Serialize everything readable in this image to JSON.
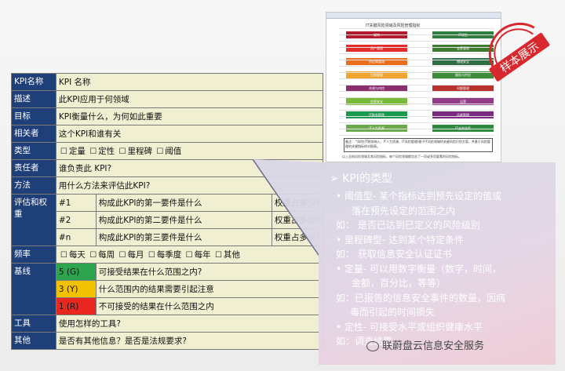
{
  "table": {
    "rows": [
      {
        "label": "KPI名称",
        "value": "KPI 名称"
      },
      {
        "label": "描述",
        "value": "此KPI应用于何领域"
      },
      {
        "label": "目标",
        "value": "KPI衡量什么，为何如此重要"
      },
      {
        "label": "相关者",
        "value": "这个KPI和谁有关"
      }
    ],
    "type_label": "类型",
    "type_options": [
      "定量",
      "定性",
      "里程碑",
      "阈值"
    ],
    "owner_label": "责任者",
    "owner_value": "谁负责此 KPI?",
    "method_label": "方法",
    "method_value": "用什么方法来评估此KPI?",
    "weight_label": "评估和权重",
    "weight_rows": [
      {
        "idx": "#1",
        "desc": "构成此KPI的第一要件是什么",
        "wt": "权重占多少?"
      },
      {
        "idx": "#2",
        "desc": "构成此KPI的第二要件是什么",
        "wt": "权重占多少?"
      },
      {
        "idx": "#n",
        "desc": "构成此KPI的第三要件是什么",
        "wt": "权重占多少?"
      }
    ],
    "freq_label": "频率",
    "freq_options": [
      "每天",
      "每周",
      "每月",
      "每季度",
      "每年",
      "其他"
    ],
    "baseline_label": "基线",
    "baseline_rows": [
      {
        "level": "5 (G)",
        "desc": "可接受结果在什么范围之内?"
      },
      {
        "level": "3 (Y)",
        "desc": "什么范围内的结果需要引起注意"
      },
      {
        "level": "1 (R)",
        "desc": "不可接受的结果在什么范围之内"
      }
    ],
    "tools_label": "工具",
    "tools_value": "使用怎样的工具?",
    "other_label": "其他",
    "other_value": "是否有其他信息？是否是法规要求?"
  },
  "sheet": {
    "title": "IT关键风险领域及风险管理指标",
    "bars": [
      {
        "label": "架构",
        "color": "#b01c2e"
      },
      {
        "label": "IT项目",
        "color": "#2c7d3e"
      },
      {
        "label": "资产管理",
        "color": "#e32d2d"
      },
      {
        "label": "变更管理",
        "color": "#3f7a31"
      },
      {
        "label": "供应商管理",
        "color": "#ec6e1c"
      },
      {
        "label": "物理安全",
        "color": "#2f6d46"
      },
      {
        "label": "日常管理",
        "color": "#f0a431"
      },
      {
        "label": "服务与供应",
        "color": "#3c8c3a"
      },
      {
        "label": "合规与内控",
        "color": "#8a2f6e"
      },
      {
        "label": "问题管理",
        "color": "#b8322e"
      },
      {
        "label": "信息安全",
        "color": "#7ab83a"
      },
      {
        "label": "运营",
        "color": "#933b86"
      },
      {
        "label": "IT财务管理",
        "color": "#1a9a4f"
      },
      {
        "label": "运维管理",
        "color": "#7b2b7f"
      },
      {
        "label": "IT人力资源",
        "color": "#6aaa4a"
      },
      {
        "label": "IT业务连续",
        "color": "#2e8a3f"
      }
    ],
    "note_title": "备注：",
    "note_text": "*风险(IT财务纳入、IT人力资源、IT风险管理)基于IT风险领域的关键风险识别方案，并基于风险管理的关键指标的对照表。",
    "footer": "以上总结风险领域及其风险指标，每个风险领域都包含了一项或多项要素的风险指标。"
  },
  "stamp_text": "样本展示",
  "colors": {
    "label_bg": "#1f3f78",
    "table_bg": "#f1efd2",
    "green": "#2ea44f",
    "yellow": "#f2c200",
    "red": "#e8271e"
  },
  "callout": {
    "heading": "KPI的类型",
    "items": [
      {
        "kind": "bullet",
        "text": "阈值型- 某个指标达到预先设定的值或"
      },
      {
        "kind": "cont",
        "text": "落在预先设定的范围之内"
      },
      {
        "kind": "example",
        "text": "如： 是否已达到已定义的风险级别"
      },
      {
        "kind": "bullet",
        "text": "里程碑型- 达到某个特定条件"
      },
      {
        "kind": "example",
        "text": "如： 获取信息安全认证证书"
      },
      {
        "kind": "bullet",
        "text": "定量- 可以用数字衡量（数字，时间，"
      },
      {
        "kind": "cont",
        "text": "金额，百分比，等等）"
      },
      {
        "kind": "example",
        "text": "如：已报告的信息安全事件的数量，因病"
      },
      {
        "kind": "cont2",
        "text": "毒而引起的时间损失"
      },
      {
        "kind": "bullet",
        "text": "定性- 可接受水平或组织健康水平"
      },
      {
        "kind": "example",
        "text": "如：调查结果"
      }
    ]
  },
  "watermark": "联蔚盘云信息安全服务"
}
